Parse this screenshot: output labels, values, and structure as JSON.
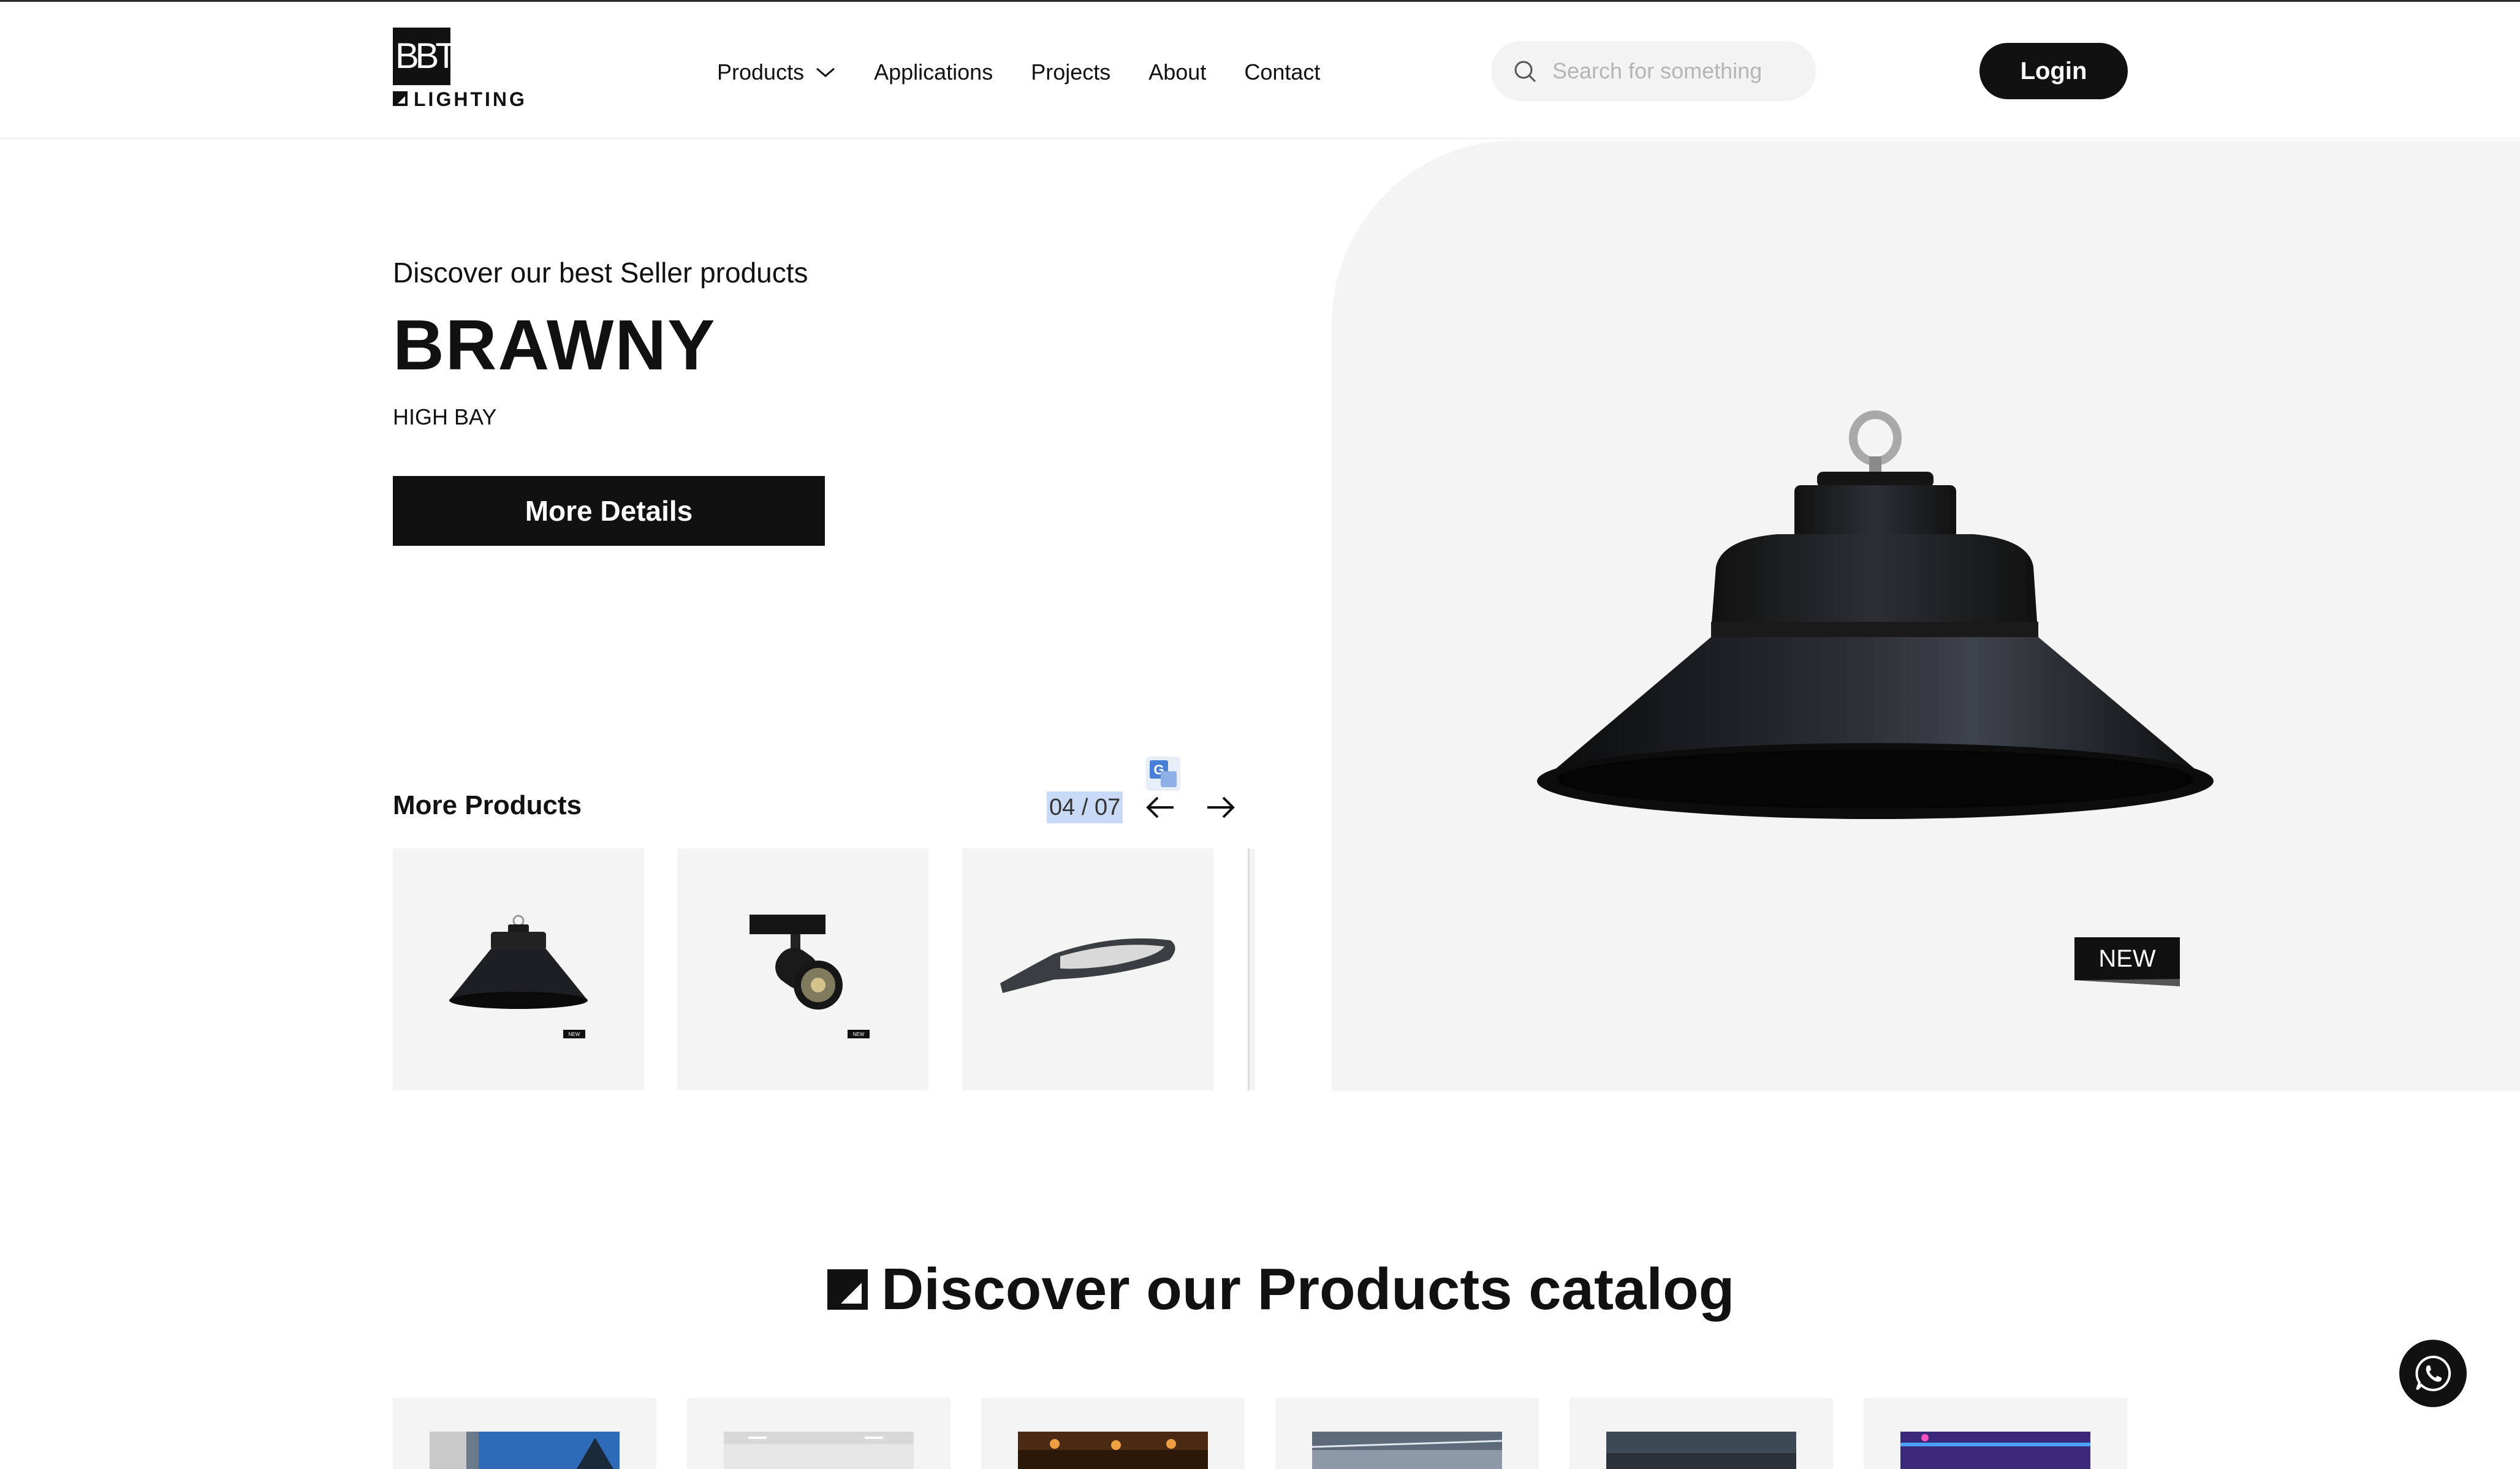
{
  "header": {
    "logo_text": "LIGHTING",
    "logo_initials": "BBT",
    "nav": [
      {
        "label": "Products",
        "has_dropdown": true
      },
      {
        "label": "Applications"
      },
      {
        "label": "Projects"
      },
      {
        "label": "About"
      },
      {
        "label": "Contact"
      }
    ],
    "search": {
      "placeholder": "Search for something",
      "value": ""
    },
    "login_label": "Login"
  },
  "hero": {
    "eyebrow": "Discover our best Seller products",
    "title": "BRAWNY",
    "subtitle": "HIGH BAY",
    "button_label": "More Details",
    "badge": "NEW"
  },
  "more_products": {
    "title": "More Products",
    "counter": "04 / 07",
    "cards": [
      {
        "icon": "high-bay-lamp",
        "badge": "NEW"
      },
      {
        "icon": "track-spotlight",
        "badge": "NEW"
      },
      {
        "icon": "street-light"
      }
    ]
  },
  "catalog": {
    "title": "Discover our Products catalog"
  },
  "colors": {
    "accent": "#111111",
    "panel": "#f4f4f4",
    "highlight": "#c8daf5"
  }
}
